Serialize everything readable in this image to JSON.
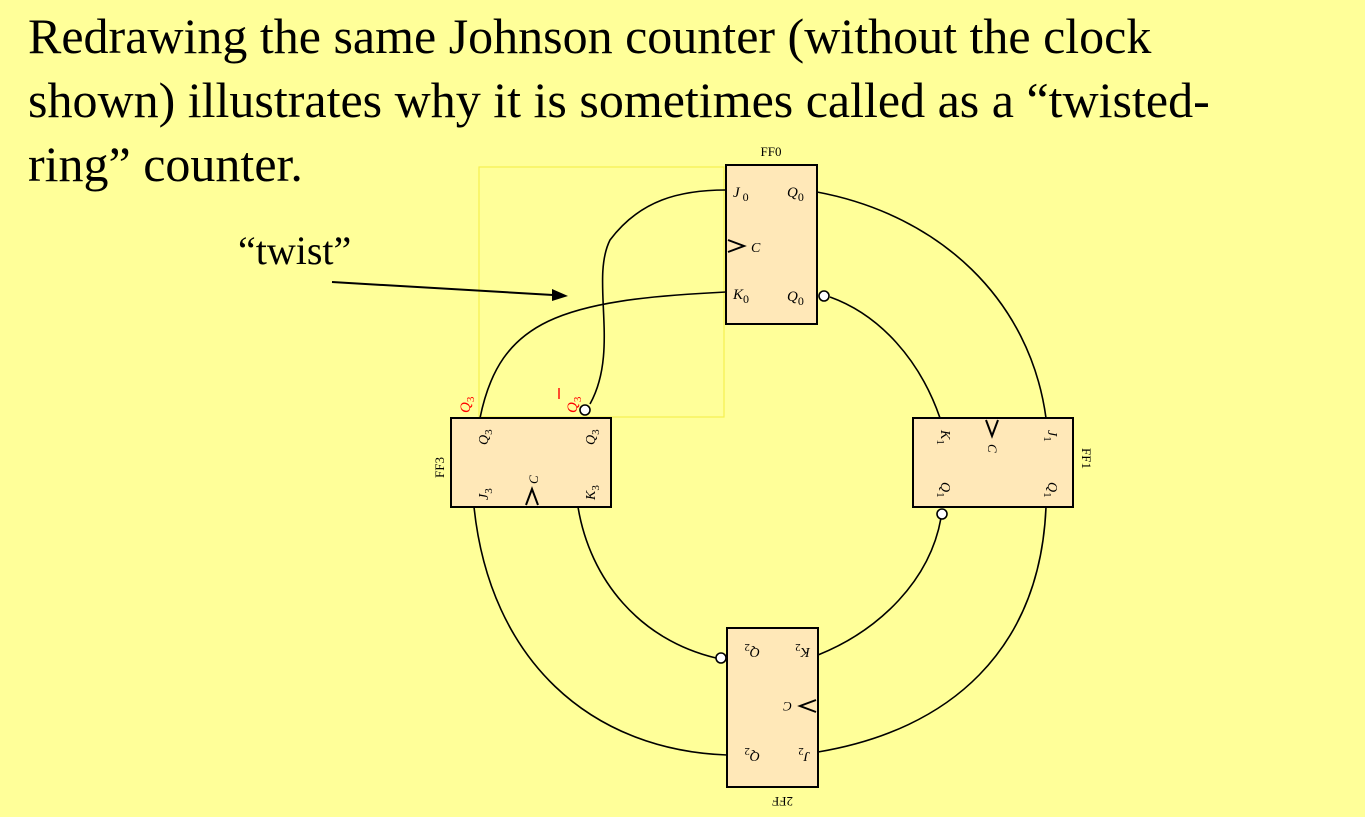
{
  "slide": {
    "title": "Redrawing the same Johnson counter (without the clock\nshown) illustrates why it is sometimes called as a “twisted-\nring” counter.",
    "twist_label": "“twist”"
  },
  "diagram": {
    "colors": {
      "background": "#ffff99",
      "flipflop_fill": "#ffe8b8",
      "highlight": "#ff0000",
      "selection_box": "#ffff44"
    },
    "ff0": {
      "name": "FF0",
      "j": "J",
      "j_sub": "0",
      "k": "K",
      "k_sub": "0",
      "clock": "C",
      "q": "Q",
      "q_sub": "0",
      "qbar": "Q",
      "qbar_sub": "0"
    },
    "ff1": {
      "name": "FF1",
      "j": "J",
      "j_sub": "1",
      "k": "K",
      "k_sub": "1",
      "clock": "C",
      "q": "Q",
      "q_sub": "1",
      "qbar": "Q",
      "qbar_sub": "1"
    },
    "ff2": {
      "name": "2FF",
      "j": "J",
      "j_sub": "2",
      "k": "K",
      "k_sub": "2",
      "clock": "C",
      "q": "Q",
      "q_sub": "2",
      "qbar": "Q",
      "qbar_sub": "2"
    },
    "ff3": {
      "name": "FF3",
      "j": "J",
      "j_sub": "3",
      "k": "K",
      "k_sub": "3",
      "clock": "C",
      "q": "Q",
      "q_sub": "3",
      "qbar": "Q",
      "qbar_sub": "3"
    },
    "q3_highlight": "Q",
    "q3_highlight_sub": "3",
    "q3bar_highlight": "Q",
    "q3bar_highlight_sub": "3"
  }
}
